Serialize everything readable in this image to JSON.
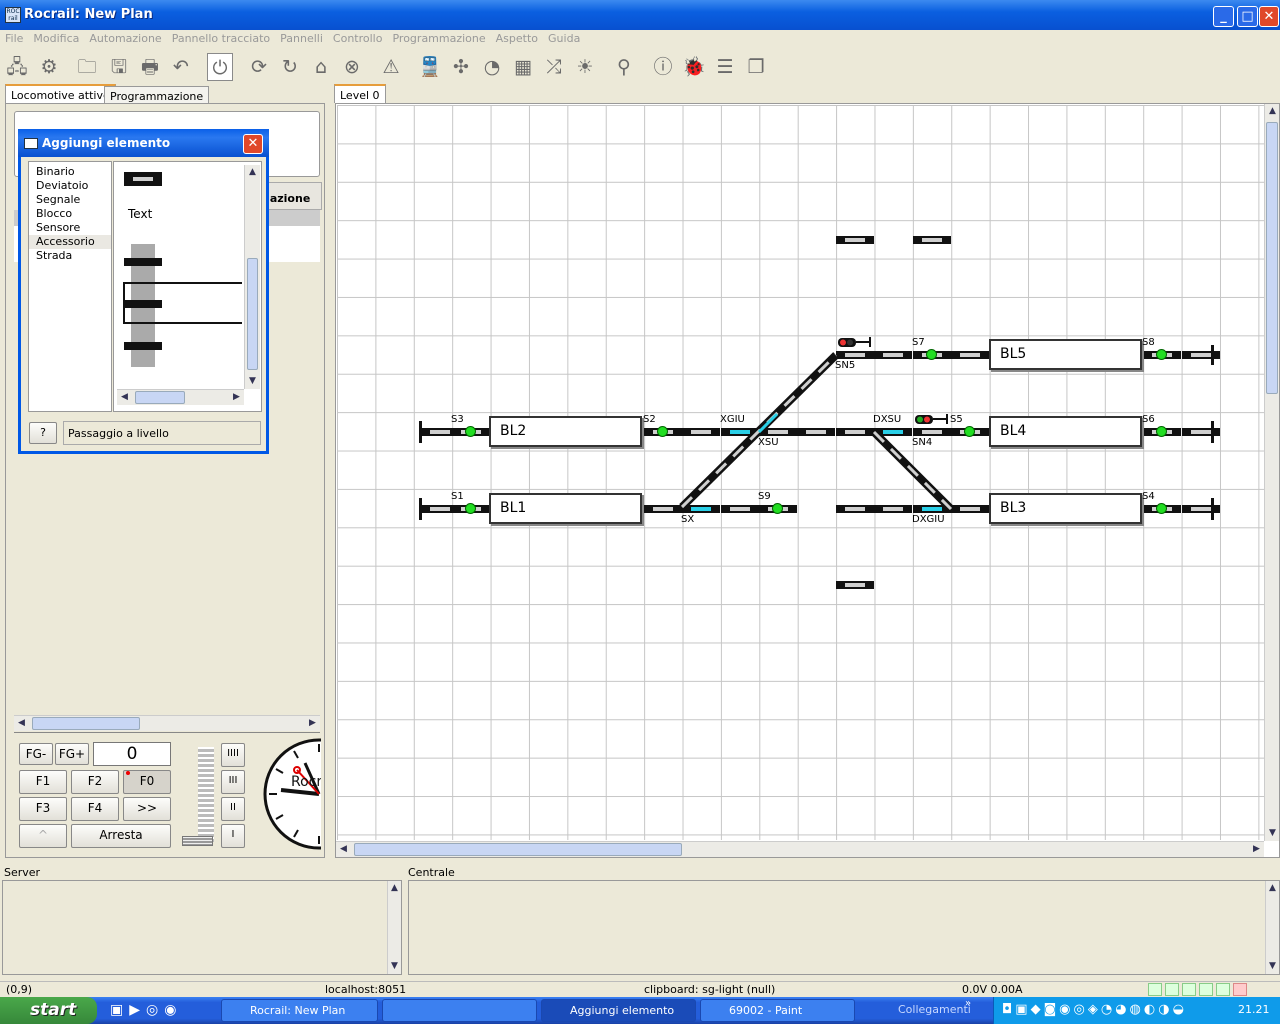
{
  "window": {
    "title": "Rocrail: New Plan"
  },
  "menu": [
    "File",
    "Modifica",
    "Automazione",
    "Pannello tracciato",
    "Pannelli",
    "Controllo",
    "Programmazione",
    "Aspetto",
    "Guida"
  ],
  "left_tabs": {
    "active": "Locomotive attive",
    "other": "Programmazione"
  },
  "loco_table": {
    "col_header_partial": "nazione"
  },
  "plan_tab": "Level 0",
  "dialog": {
    "title": "Aggiungi elemento",
    "categories": [
      "Binario",
      "Deviatoio",
      "Segnale",
      "Blocco",
      "Sensore",
      "Accessorio",
      "Strada"
    ],
    "selected_category": "Accessorio",
    "text_item": "Text",
    "help_button": "?",
    "selected_item_name": "Passaggio a livello"
  },
  "loco_control": {
    "fg_minus": "FG-",
    "fg_plus": "FG+",
    "speed": "0",
    "f1": "F1",
    "f2": "F2",
    "f0": "F0",
    "f3": "F3",
    "f4": "F4",
    "more": ">>",
    "dir": "^",
    "stop": "Arresta",
    "gear4": "IIII",
    "gear3": "III",
    "gear2": "II",
    "gear1": "I",
    "clock_brand": "Rocrail"
  },
  "blocks": [
    "BL5",
    "BL2",
    "BL4",
    "BL1",
    "BL3"
  ],
  "labels": {
    "s3": "S3",
    "s2": "S2",
    "s1": "S1",
    "s9": "S9",
    "s7": "S7",
    "s8": "S8",
    "s5": "S5",
    "s6": "S6",
    "s4": "S4",
    "sn5": "SN5",
    "sn4": "SN4",
    "xgiu": "XGIU",
    "xsu": "XSU",
    "sx": "SX",
    "dxsu": "DXSU",
    "dxgiu": "DXGIU"
  },
  "bottom": {
    "server": "Server",
    "centrale": "Centrale"
  },
  "status": {
    "coords": "(0,9)",
    "host": "localhost:8051",
    "clipboard": "clipboard: sg-light (null)",
    "power": "0.0V 0.00A"
  },
  "taskbar": {
    "start": "start",
    "tasks": [
      "Rocrail: New Plan",
      "",
      "Aggiungi elemento",
      "69002 - Paint"
    ],
    "links": "Collegamenti",
    "time": "21.21"
  }
}
